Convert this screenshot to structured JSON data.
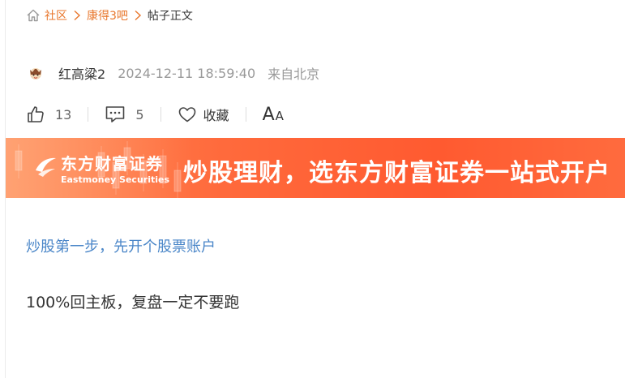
{
  "breadcrumb": {
    "community": "社区",
    "forum": "康得3吧",
    "current": "帖子正文"
  },
  "author": {
    "name": "红高粱2",
    "time": "2024-12-11 18:59:40",
    "location": "来自北京"
  },
  "actions": {
    "likes": "13",
    "comments": "5",
    "favorite_label": "收藏",
    "font_big": "A",
    "font_small": "A"
  },
  "banner": {
    "brand_cn": "东方财富证券",
    "brand_en": "Eastmoney Securities",
    "slogan": "炒股理财，选东方财富证券一站式开户"
  },
  "promo_link": "炒股第一步，先开个股票账户",
  "post_body": "100%回主板，复盘一定不要跑",
  "colors": {
    "accent_orange": "#e8762b",
    "link_blue": "#4a86c8",
    "banner_orange": "#ff6a3c"
  }
}
